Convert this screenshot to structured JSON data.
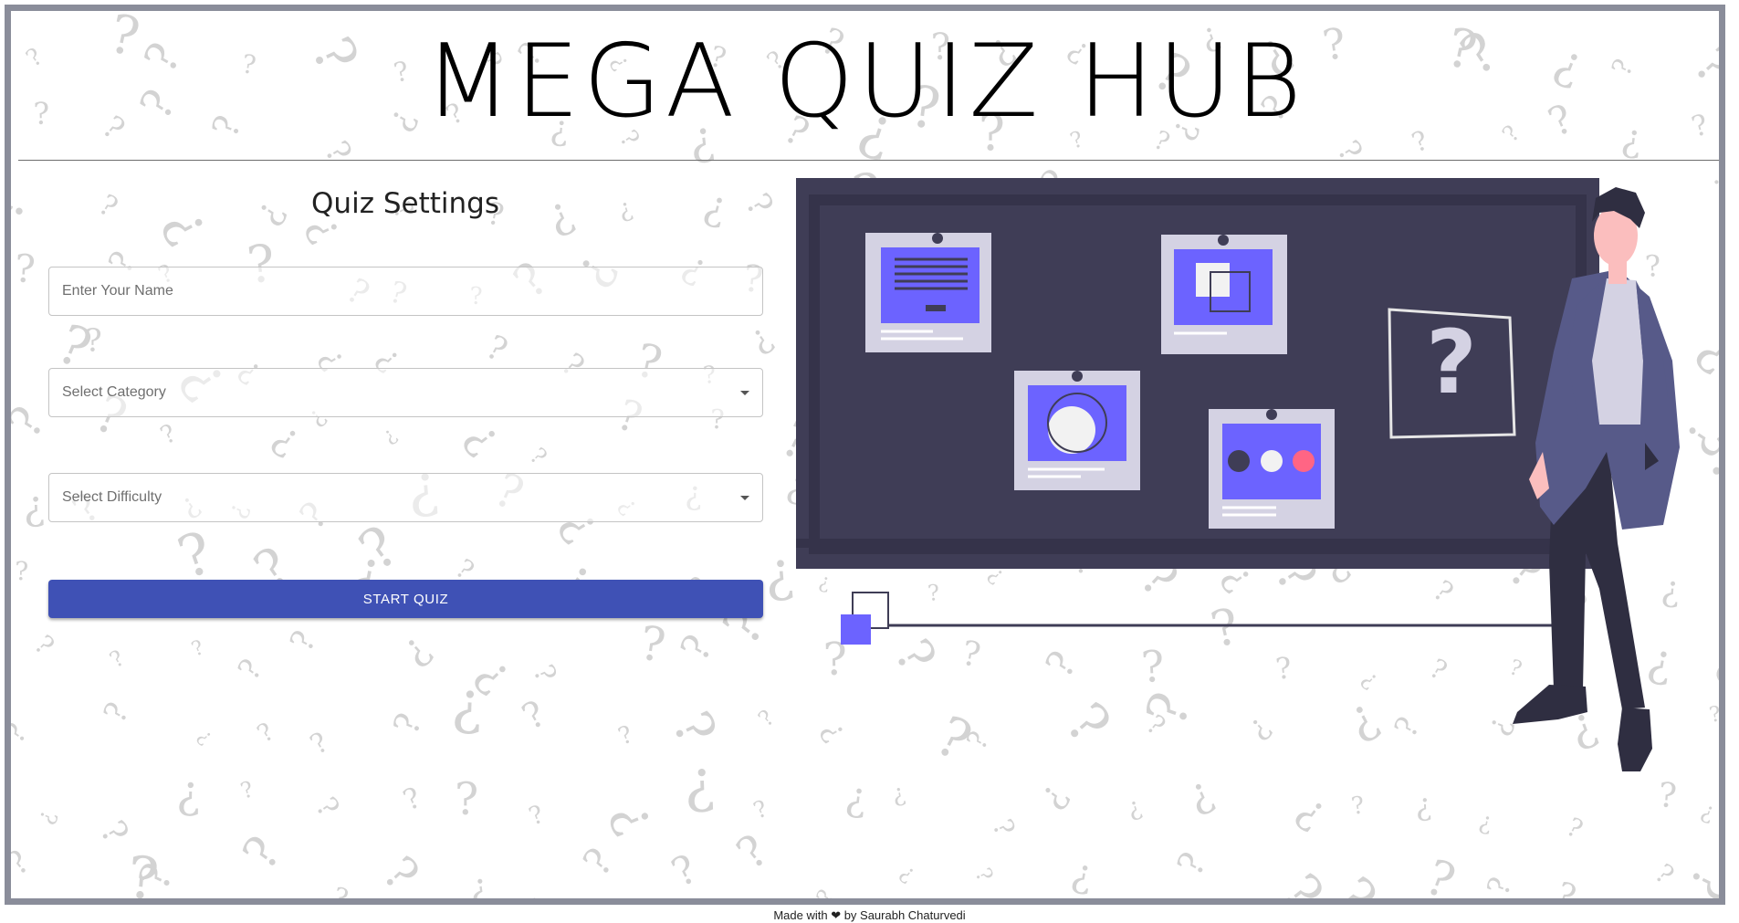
{
  "app": {
    "title": "MEGA QUIZ HUB"
  },
  "settings": {
    "heading": "Quiz Settings",
    "name_placeholder": "Enter Your Name",
    "category_label": "Select Category",
    "difficulty_label": "Select Difficulty",
    "start_label": "START QUIZ"
  },
  "illustration": {
    "board_symbol": "?",
    "icons": [
      "question-mark-board-icon",
      "presenter-figure"
    ]
  },
  "footer": {
    "text": "Made with ❤ by Saurabh Chaturvedi"
  },
  "colors": {
    "primary": "#3f51b5",
    "board": "#3f3d56",
    "card_accent": "#6c63ff",
    "frame_border": "#8a8d9a"
  }
}
